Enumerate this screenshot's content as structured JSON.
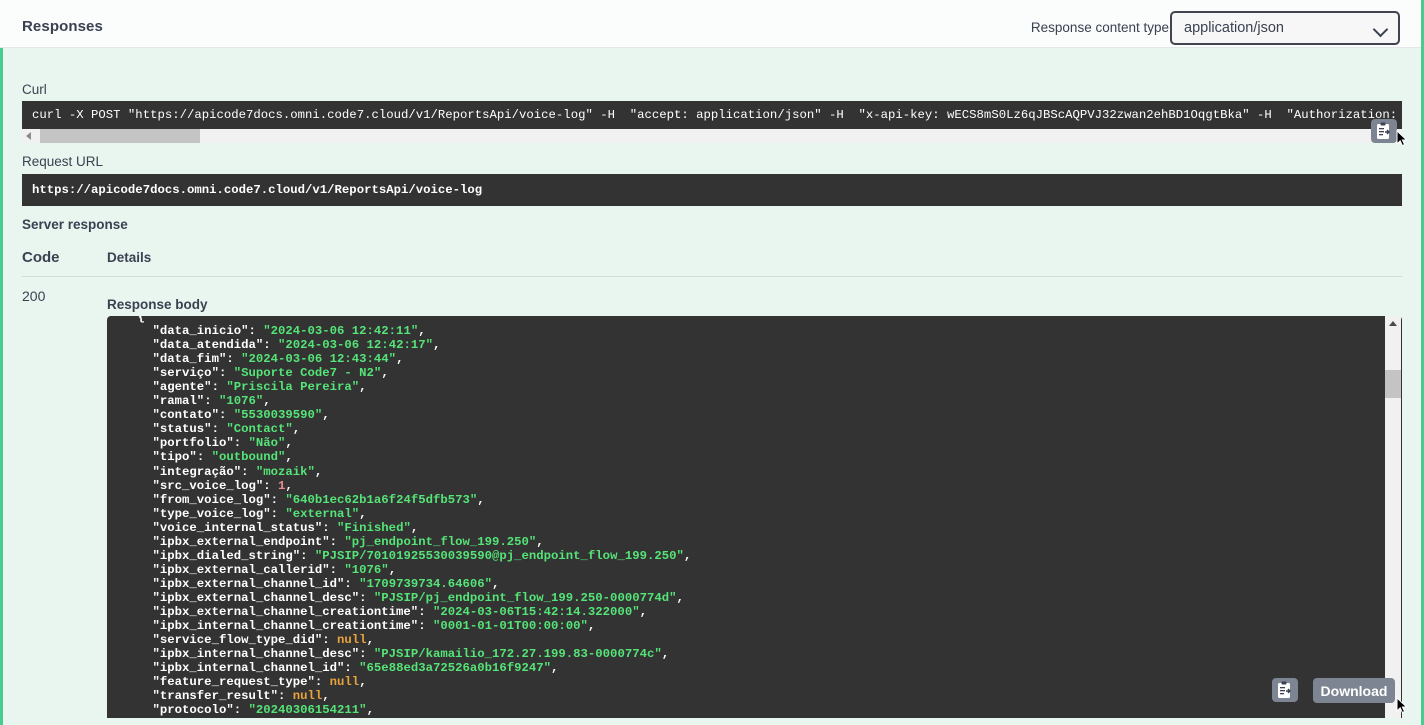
{
  "header": {
    "title": "Responses",
    "content_type_label": "Response content type",
    "content_type_value": "application/json",
    "chevron_icon": "chevron-down-icon"
  },
  "curl": {
    "label": "Curl",
    "command": "curl -X POST \"https://apicode7docs.omni.code7.cloud/v1/ReportsApi/voice-log\" -H  \"accept: application/json\" -H  \"x-api-key: wECS8mS0Lz6qJBScAQPVJ32zwan2ehBD1OqgtBka\" -H  \"Authorization: Bearer eyJhbGciOiJIUzI",
    "copy_icon": "copy-icon"
  },
  "request_url": {
    "label": "Request URL",
    "value": "https://apicode7docs.omni.code7.cloud/v1/ReportsApi/voice-log"
  },
  "server_response": {
    "label": "Server response",
    "columns": [
      "Code",
      "Details"
    ],
    "code": "200",
    "response_body_label": "Response body"
  },
  "response_body": {
    "lines": [
      {
        "indent": 4,
        "key": "data_inicio",
        "value": "\"2024-03-06 12:42:11\"",
        "type": "string"
      },
      {
        "indent": 4,
        "key": "data_atendida",
        "value": "\"2024-03-06 12:42:17\"",
        "type": "string"
      },
      {
        "indent": 4,
        "key": "data_fim",
        "value": "\"2024-03-06 12:43:44\"",
        "type": "string"
      },
      {
        "indent": 4,
        "key": "serviço",
        "value": "\"Suporte Code7 - N2\"",
        "type": "string"
      },
      {
        "indent": 4,
        "key": "agente",
        "value": "\"Priscila Pereira\"",
        "type": "string"
      },
      {
        "indent": 4,
        "key": "ramal",
        "value": "\"1076\"",
        "type": "string"
      },
      {
        "indent": 4,
        "key": "contato",
        "value": "\"5530039590\"",
        "type": "string"
      },
      {
        "indent": 4,
        "key": "status",
        "value": "\"Contact\"",
        "type": "string"
      },
      {
        "indent": 4,
        "key": "portfolio",
        "value": "\"Não\"",
        "type": "string"
      },
      {
        "indent": 4,
        "key": "tipo",
        "value": "\"outbound\"",
        "type": "string"
      },
      {
        "indent": 4,
        "key": "integração",
        "value": "\"mozaik\"",
        "type": "string"
      },
      {
        "indent": 4,
        "key": "src_voice_log",
        "value": "1",
        "type": "number"
      },
      {
        "indent": 4,
        "key": "from_voice_log",
        "value": "\"640b1ec62b1a6f24f5dfb573\"",
        "type": "string"
      },
      {
        "indent": 4,
        "key": "type_voice_log",
        "value": "\"external\"",
        "type": "string"
      },
      {
        "indent": 4,
        "key": "voice_internal_status",
        "value": "\"Finished\"",
        "type": "string"
      },
      {
        "indent": 4,
        "key": "ipbx_external_endpoint",
        "value": "\"pj_endpoint_flow_199.250\"",
        "type": "string"
      },
      {
        "indent": 4,
        "key": "ipbx_dialed_string",
        "value": "\"PJSIP/70101925530039590@pj_endpoint_flow_199.250\"",
        "type": "string"
      },
      {
        "indent": 4,
        "key": "ipbx_external_callerid",
        "value": "\"1076\"",
        "type": "string"
      },
      {
        "indent": 4,
        "key": "ipbx_external_channel_id",
        "value": "\"1709739734.64606\"",
        "type": "string"
      },
      {
        "indent": 4,
        "key": "ipbx_external_channel_desc",
        "value": "\"PJSIP/pj_endpoint_flow_199.250-0000774d\"",
        "type": "string"
      },
      {
        "indent": 4,
        "key": "ipbx_external_channel_creationtime",
        "value": "\"2024-03-06T15:42:14.322000\"",
        "type": "string"
      },
      {
        "indent": 4,
        "key": "ipbx_internal_channel_creationtime",
        "value": "\"0001-01-01T00:00:00\"",
        "type": "string"
      },
      {
        "indent": 4,
        "key": "service_flow_type_did",
        "value": "null",
        "type": "null"
      },
      {
        "indent": 4,
        "key": "ipbx_internal_channel_desc",
        "value": "\"PJSIP/kamailio_172.27.199.83-0000774c\"",
        "type": "string"
      },
      {
        "indent": 4,
        "key": "ipbx_internal_channel_id",
        "value": "\"65e88ed3a72526a0b16f9247\"",
        "type": "string"
      },
      {
        "indent": 4,
        "key": "feature_request_type",
        "value": "null",
        "type": "null"
      },
      {
        "indent": 4,
        "key": "transfer_result",
        "value": "null",
        "type": "null"
      },
      {
        "indent": 4,
        "key": "protocolo",
        "value": "\"20240306154211\"",
        "type": "string"
      }
    ],
    "copy_icon": "copy-icon",
    "download_label": "Download"
  },
  "colors": {
    "accent_green": "#49cc90",
    "page_bg": "#e8f6ef",
    "header_bg": "#fbfcfc",
    "code_bg": "#333333",
    "string_green": "#55e477",
    "number_red": "#f08d8d",
    "null_orange": "#e8a33d",
    "button_gray": "#7d8492"
  }
}
